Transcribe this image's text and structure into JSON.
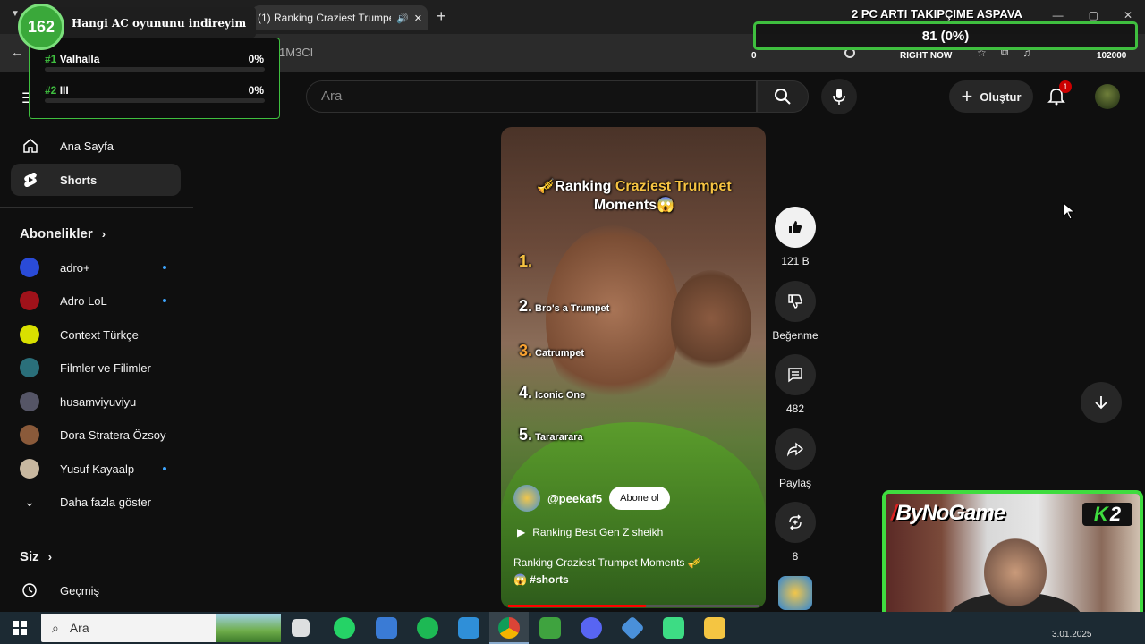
{
  "browser": {
    "tab_title": "(1) Ranking Craziest Trumpet",
    "url_fragment": "1M3CI"
  },
  "header": {
    "search_placeholder": "Ara",
    "create_label": "Oluştur",
    "notification_count": "1"
  },
  "sidebar": {
    "nav": [
      {
        "label": "Ana Sayfa"
      },
      {
        "label": "Shorts"
      }
    ],
    "subscriptions_title": "Abonelikler",
    "subscriptions": [
      {
        "name": "adro+",
        "color": "#2a4bd8",
        "new": true
      },
      {
        "name": "Adro LoL",
        "color": "#a0121a",
        "new": true
      },
      {
        "name": "Context Türkçe",
        "color": "#d9e000",
        "new": false
      },
      {
        "name": "Filmler ve Filimler",
        "color": "#2a6f7a",
        "new": false
      },
      {
        "name": "husamviyuviyu",
        "color": "#555566",
        "new": false
      },
      {
        "name": "Dora Stratera Özsoy",
        "color": "#8a5a3a",
        "new": false
      },
      {
        "name": "Yusuf Kayaalp",
        "color": "#c8b8a0",
        "new": true
      }
    ],
    "show_more": "Daha fazla göster",
    "you_title": "Siz",
    "history": "Geçmiş"
  },
  "short": {
    "title_part1": "🎺Ranking ",
    "title_highlight": "Craziest Trumpet",
    "title_part2": "Moments😱",
    "ranks": [
      {
        "num": "1.",
        "text": ""
      },
      {
        "num": "2.",
        "text": "Bro's a Trumpet"
      },
      {
        "num": "3.",
        "text": "Catrumpet"
      },
      {
        "num": "4.",
        "text": "Iconic One"
      },
      {
        "num": "5.",
        "text": "Tarararara"
      }
    ],
    "channel": "@peekaf5",
    "subscribe_label": "Abone ol",
    "playlist": "Ranking Best Gen Z sheikh",
    "description": "Ranking Craziest Trumpet Moments 🎺",
    "description_line2": "😱",
    "hashtag": "#shorts",
    "progress": 0.55
  },
  "actions": {
    "likes": "121 B",
    "dislike_label": "Beğenme",
    "comments": "482",
    "share_label": "Paylaş",
    "remix_count": "8"
  },
  "overlays": {
    "poll": {
      "count": "162",
      "question": "Hangi AC oyununu indireyim",
      "options": [
        {
          "rank": "#1",
          "name": "Valhalla",
          "percent": "0%"
        },
        {
          "rank": "#2",
          "name": "III",
          "percent": "0%"
        }
      ]
    },
    "goal": {
      "title": "2 PC ARTI TAKIPÇIME ASPAVA",
      "value": "81 (0%)",
      "min": "0",
      "now_label": "RIGHT NOW",
      "max": "102000"
    },
    "cam": {
      "brand": "ByNoGame",
      "logo_k": "K",
      "logo_2": "2"
    },
    "clock": "3.01.2025"
  },
  "taskbar": {
    "search_placeholder": "Ara"
  },
  "colors": {
    "accent_green": "#3fbf3f",
    "youtube_red": "#ff0000",
    "highlight_yellow": "#f6c342"
  }
}
